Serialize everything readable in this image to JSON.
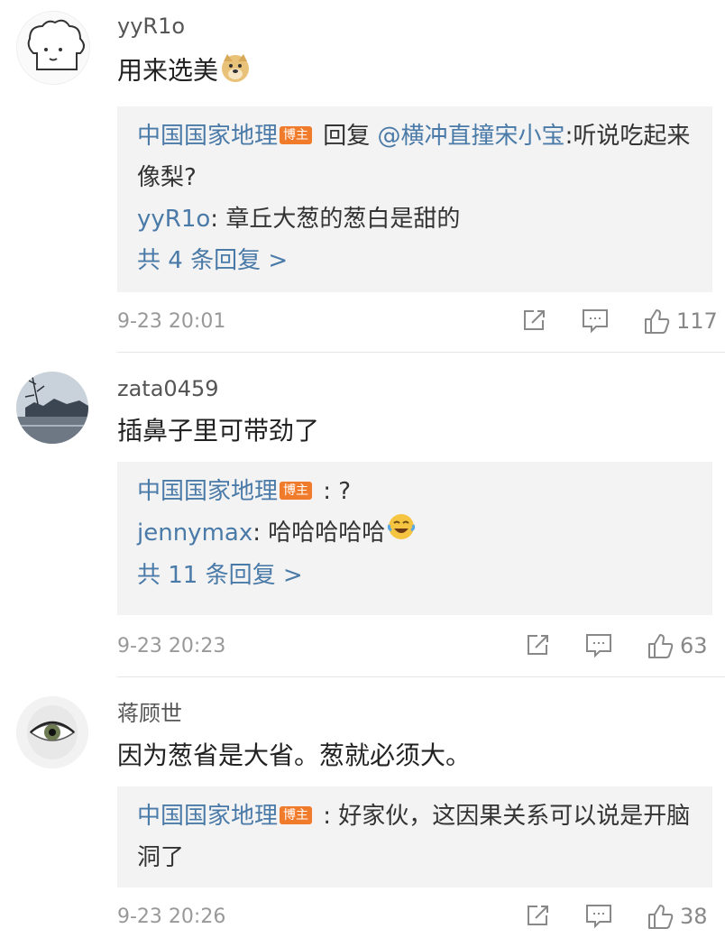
{
  "comments": [
    {
      "username": "yyR1o",
      "text": "用来选美",
      "replies": [
        {
          "name": "中国国家地理",
          "badge": "博主",
          "middle": " 回复 ",
          "mention": "@横冲直撞宋小宝",
          "text": ":听说吃起来像梨?"
        },
        {
          "name": "yyR1o",
          "text": ": 章丘大葱的葱白是甜的"
        }
      ],
      "more": "共 4 条回复 >",
      "time": "9-23 20:01",
      "likes": "117"
    },
    {
      "username": "zata0459",
      "text": "插鼻子里可带劲了",
      "replies": [
        {
          "name": "中国国家地理",
          "badge": "博主",
          "text": " : ?"
        },
        {
          "name": "jennymax",
          "text": ": 哈哈哈哈哈"
        }
      ],
      "more": "共 11 条回复 >",
      "time": "9-23 20:23",
      "likes": "63"
    },
    {
      "username": "蒋顾世",
      "text": "因为葱省是大省。葱就必须大。",
      "replies": [
        {
          "name": "中国国家地理",
          "badge": "博主",
          "text": " : 好家伙，这因果关系可以说是开脑洞了"
        }
      ],
      "time": "9-23 20:26",
      "likes": "38"
    }
  ]
}
